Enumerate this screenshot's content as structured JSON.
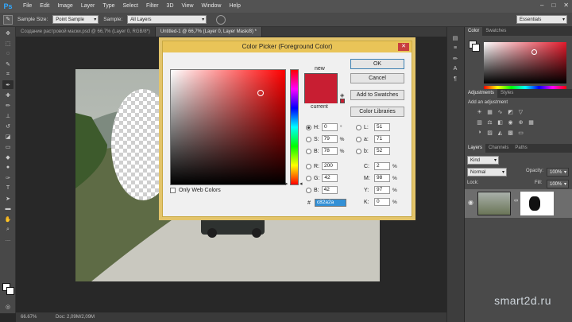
{
  "app": {
    "logo": "Ps"
  },
  "menubar": [
    "File",
    "Edit",
    "Image",
    "Layer",
    "Type",
    "Select",
    "Filter",
    "3D",
    "View",
    "Window",
    "Help"
  ],
  "window_controls": [
    "–",
    "□",
    "✕"
  ],
  "options_bar": {
    "sample_size_label": "Sample Size:",
    "sample_size_value": "Point Sample",
    "sample_label": "Sample:",
    "sample_value": "All Layers",
    "workspace": "Essentials"
  },
  "tabs": [
    {
      "label": "Создание растровой маски.psd @ 66,7% (Layer 0, RGB/8*)",
      "active": false
    },
    {
      "label": "Untitled-1 @ 66,7% (Layer 0, Layer Mask/8) *",
      "active": true
    }
  ],
  "status": {
    "zoom": "66.67%",
    "doc": "Doc: 2,09M/2,09M"
  },
  "dialog": {
    "title": "Color Picker (Foreground Color)",
    "new_label": "new",
    "current_label": "current",
    "buttons": {
      "ok": "OK",
      "cancel": "Cancel",
      "swatches": "Add to Swatches",
      "libraries": "Color Libraries"
    },
    "only_web_colors": "Only Web Colors",
    "hsb": [
      {
        "label": "H:",
        "value": "0",
        "unit": "°",
        "selected": true
      },
      {
        "label": "S:",
        "value": "79",
        "unit": "%",
        "selected": false
      },
      {
        "label": "B:",
        "value": "78",
        "unit": "%",
        "selected": false
      }
    ],
    "rgb": [
      {
        "label": "R:",
        "value": "200"
      },
      {
        "label": "G:",
        "value": "42"
      },
      {
        "label": "B:",
        "value": "42"
      }
    ],
    "lab": [
      {
        "label": "L:",
        "value": "51"
      },
      {
        "label": "a:",
        "value": "71"
      },
      {
        "label": "b:",
        "value": "52"
      }
    ],
    "cmyk": [
      {
        "label": "C:",
        "value": "2",
        "unit": "%"
      },
      {
        "label": "M:",
        "value": "98",
        "unit": "%"
      },
      {
        "label": "Y:",
        "value": "97",
        "unit": "%"
      },
      {
        "label": "K:",
        "value": "0",
        "unit": "%"
      }
    ],
    "hex_label": "#",
    "hex_value": "c82a2a",
    "new_color": "#c81e32",
    "current_color": "#c81e32"
  },
  "panels": {
    "color_tabs": [
      "Color",
      "Swatches"
    ],
    "adjust_tabs": [
      "Adjustments",
      "Styles"
    ],
    "adjust_heading": "Add an adjustment",
    "layers_tabs": [
      "Layers",
      "Channels",
      "Paths"
    ],
    "layers_filter": "Kind",
    "blend_mode": "Normal",
    "opacity_label": "Opacity:",
    "opacity_value": "100%",
    "fill_label": "Fill:",
    "fill_value": "100%",
    "lock_label": "Lock:"
  },
  "watermark": "smart2d.ru"
}
